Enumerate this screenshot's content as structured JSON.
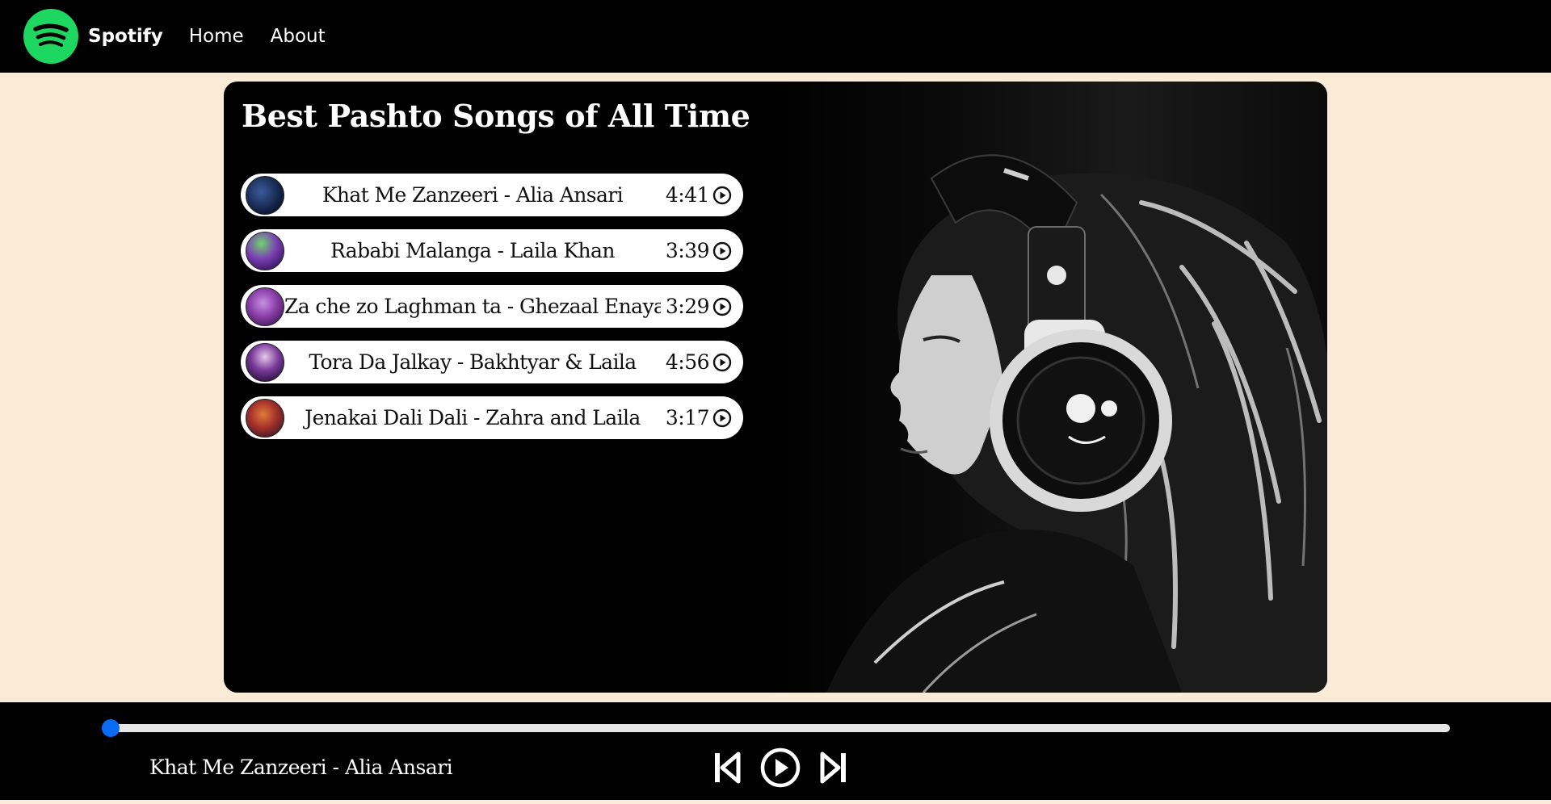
{
  "navbar": {
    "logo_icon": "spotify-logo-icon",
    "brand": "Spotify",
    "links": [
      "Home",
      "About"
    ]
  },
  "card": {
    "title": "Best Pashto Songs of All Time",
    "songs": [
      {
        "name": "Khat Me Zanzeeri - Alia Ansari",
        "duration": "4:41"
      },
      {
        "name": "Rababi Malanga - Laila Khan",
        "duration": "3:39"
      },
      {
        "name": "Za che zo Laghman ta - Ghezaal Enayat",
        "duration": "3:29"
      },
      {
        "name": "Tora Da Jalkay - Bakhtyar & Laila",
        "duration": "4:56"
      },
      {
        "name": "Jenakai Dali Dali - Zahra and Laila",
        "duration": "3:17"
      }
    ]
  },
  "player": {
    "now_playing": "Khat Me Zanzeeri - Alia Ansari",
    "progress": 0,
    "controls": [
      "previous-icon",
      "play-circle-icon",
      "next-icon"
    ]
  },
  "colors": {
    "background": "#faebd7",
    "bars": "#000000",
    "accent_green": "#1ed760",
    "progress_thumb": "#0a6cf5"
  }
}
